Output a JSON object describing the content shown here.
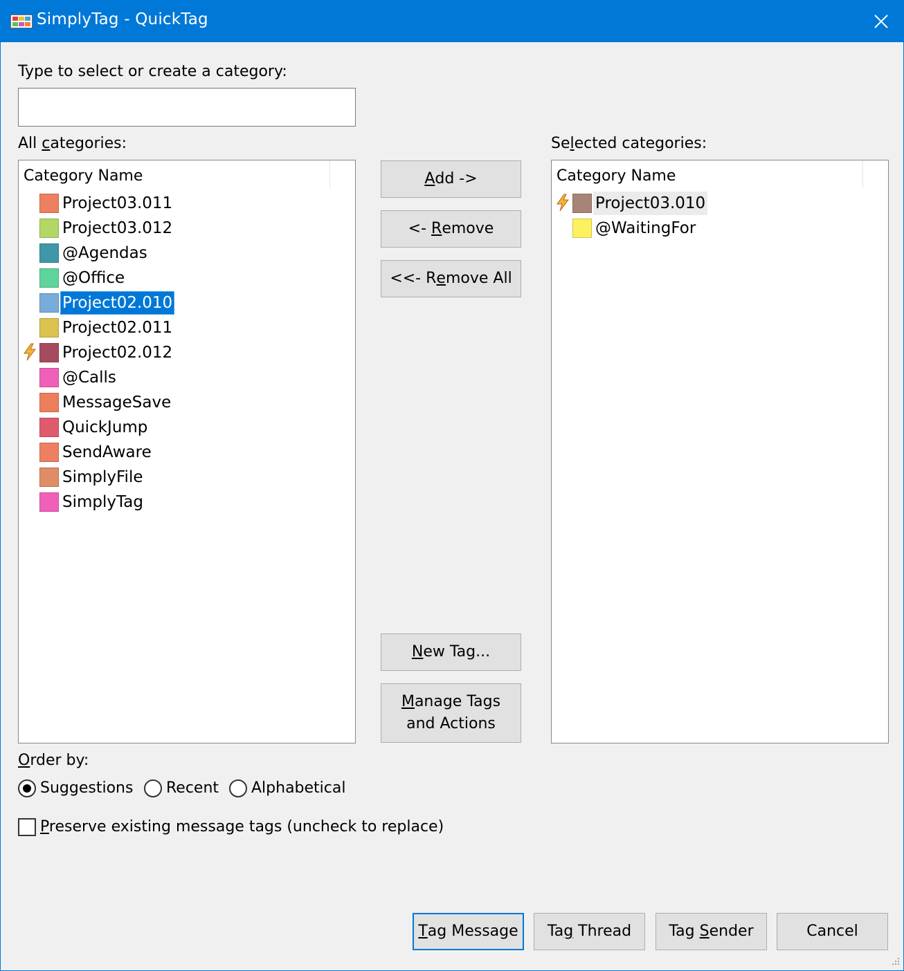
{
  "window": {
    "title": "SimplyTag - QuickTag"
  },
  "search": {
    "label": "Type to select or create a category:",
    "value": "",
    "placeholder": ""
  },
  "all_categories": {
    "label_pre": "All ",
    "label_key": "c",
    "label_post": "ategories:",
    "column_header": "Category Name",
    "items": [
      {
        "name": "Project03.011",
        "color": "#ec8060",
        "icon": "",
        "selected": false
      },
      {
        "name": "Project03.012",
        "color": "#b2d766",
        "icon": "",
        "selected": false
      },
      {
        "name": "@Agendas",
        "color": "#3f97a8",
        "icon": "",
        "selected": false
      },
      {
        "name": "@Office",
        "color": "#5ed49b",
        "icon": "",
        "selected": false
      },
      {
        "name": "Project02.010",
        "color": "#78acd9",
        "icon": "",
        "selected": true
      },
      {
        "name": "Project02.011",
        "color": "#dcc34f",
        "icon": "",
        "selected": false
      },
      {
        "name": "Project02.012",
        "color": "#a54b5f",
        "icon": "lightning-icon",
        "selected": false
      },
      {
        "name": "@Calls",
        "color": "#f060b8",
        "icon": "",
        "selected": false
      },
      {
        "name": "MessageSave",
        "color": "#ec7e5c",
        "icon": "",
        "selected": false
      },
      {
        "name": "QuickJump",
        "color": "#e05a6e",
        "icon": "",
        "selected": false
      },
      {
        "name": "SendAware",
        "color": "#ec8060",
        "icon": "",
        "selected": false
      },
      {
        "name": "SimplyFile",
        "color": "#e08c68",
        "icon": "",
        "selected": false
      },
      {
        "name": "SimplyTag",
        "color": "#f060b8",
        "icon": "",
        "selected": false
      }
    ]
  },
  "selected_categories": {
    "label_pre": "Se",
    "label_key": "l",
    "label_post": "ected categories:",
    "column_header": "Category Name",
    "items": [
      {
        "name": "Project03.010",
        "color": "#a88478",
        "icon": "lightning-icon",
        "hot": true
      },
      {
        "name": "@WaitingFor",
        "color": "#fef160",
        "icon": "",
        "hot": false
      }
    ]
  },
  "buttons": {
    "add": {
      "key": "A",
      "rest": "dd ->"
    },
    "remove": {
      "pre": "<- ",
      "key": "R",
      "rest": "emove"
    },
    "remove_all": {
      "pre": "<<- ",
      "key": "R",
      "mid": "e",
      "rest": "move All"
    },
    "new_tag": {
      "key": "N",
      "rest": "ew Tag..."
    },
    "manage_tags": {
      "key": "M",
      "rest": "anage Tags",
      "line2": "and Actions"
    },
    "tag_message": {
      "key": "T",
      "rest": "ag Message"
    },
    "tag_thread": {
      "pre": "Ta",
      "key": "g",
      "rest": " Thread"
    },
    "tag_sender": {
      "pre": "Tag ",
      "key": "S",
      "rest": "ender"
    },
    "cancel": {
      "label": "Cancel"
    }
  },
  "order_by": {
    "label_key": "O",
    "label_rest": "rder by:",
    "options": [
      {
        "label": "Suggestions",
        "checked": true
      },
      {
        "label": "Recent",
        "checked": false
      },
      {
        "label": "Alphabetical",
        "checked": false
      }
    ]
  },
  "preserve": {
    "key": "P",
    "rest": "reserve existing message tags (uncheck to replace)",
    "checked": false
  },
  "colors": {
    "accent": "#0078d7",
    "dialog_bg": "#f0f0f0",
    "button_bg": "#e1e1e1"
  }
}
